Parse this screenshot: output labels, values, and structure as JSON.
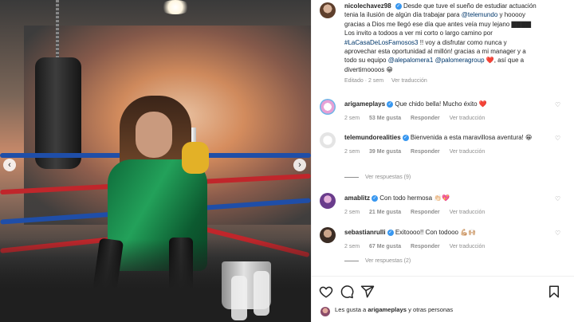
{
  "post": {
    "username": "nicolechavez98",
    "caption_text": "Desde que tuve el sueño de estudiar actuación tenia la ilusión de algún día trabajar para",
    "mention_telemundo": "@telemundo",
    "caption_text2": "y hooooy gracias a Dios me llegó ese día que antes veía muy lejano",
    "emoji_block": "▇▇▇▇",
    "caption_text3": "Los invito a todoos a ver mi corto o largo camino por",
    "hashtag": "#LaCasaDeLosFamosos3",
    "caption_text4": "!! voy a disfrutar como nunca y aprovechar esta oportunidad al millón! gracias a mi manager y a todo su equipo",
    "mention_1": "@alepalomera1",
    "mention_2": "@palomeragroup",
    "emoji_heart": "❤️",
    "caption_text5": ", así que a divertirnoooos",
    "emoji_smile": "😁",
    "edited_label": "Editado",
    "time": "2 sem",
    "see_translation": "Ver traducción"
  },
  "comments": [
    {
      "username": "arigameplays",
      "verified": true,
      "text": "Que chido bella! Mucho éxito",
      "emoji": "❤️",
      "time": "2 sem",
      "likes": "53 Me gusta",
      "reply": "Responder",
      "see_translation": "Ver traducción",
      "replies": ""
    },
    {
      "username": "telemundorealities",
      "verified": true,
      "text": "Bienvenida a esta maravillosa aventura!",
      "emoji": "😁",
      "time": "2 sem",
      "likes": "39 Me gusta",
      "reply": "Responder",
      "see_translation": "Ver traducción",
      "replies": "Ver respuestas (9)"
    },
    {
      "username": "amablitz",
      "verified": true,
      "text": "Con todo hermosa",
      "emoji": "👏🏻💖",
      "time": "2 sem",
      "likes": "21 Me gusta",
      "reply": "Responder",
      "see_translation": "Ver traducción",
      "replies": ""
    },
    {
      "username": "sebastianrulli",
      "verified": true,
      "text": "Exitoooo!! Con todooo",
      "emoji": "💪🏼🙌🏼",
      "time": "2 sem",
      "likes": "67 Me gusta",
      "reply": "Responder",
      "see_translation": "Ver traducción",
      "replies": "Ver respuestas (2)"
    }
  ],
  "likes_line": {
    "prefix": "Les gusta a",
    "user": "arigameplays",
    "suffix": "y otras personas"
  },
  "colors": {
    "accent_blue": "#00376b",
    "verified": "#3897f0",
    "heart_red": "#ed4956"
  },
  "icons": [
    "heart-icon",
    "comment-icon",
    "share-icon",
    "bookmark-icon",
    "chevron-left-icon",
    "chevron-right-icon"
  ]
}
